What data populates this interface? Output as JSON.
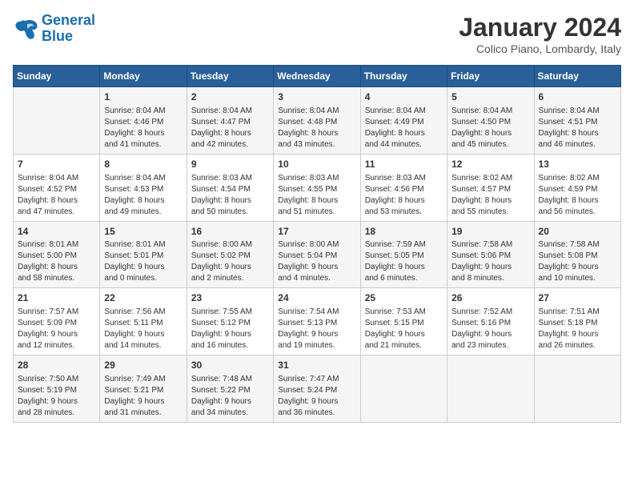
{
  "logo": {
    "text_general": "General",
    "text_blue": "Blue"
  },
  "header": {
    "month": "January 2024",
    "location": "Colico Piano, Lombardy, Italy"
  },
  "weekdays": [
    "Sunday",
    "Monday",
    "Tuesday",
    "Wednesday",
    "Thursday",
    "Friday",
    "Saturday"
  ],
  "weeks": [
    [
      {
        "day": "",
        "info": ""
      },
      {
        "day": "1",
        "info": "Sunrise: 8:04 AM\nSunset: 4:46 PM\nDaylight: 8 hours\nand 41 minutes."
      },
      {
        "day": "2",
        "info": "Sunrise: 8:04 AM\nSunset: 4:47 PM\nDaylight: 8 hours\nand 42 minutes."
      },
      {
        "day": "3",
        "info": "Sunrise: 8:04 AM\nSunset: 4:48 PM\nDaylight: 8 hours\nand 43 minutes."
      },
      {
        "day": "4",
        "info": "Sunrise: 8:04 AM\nSunset: 4:49 PM\nDaylight: 8 hours\nand 44 minutes."
      },
      {
        "day": "5",
        "info": "Sunrise: 8:04 AM\nSunset: 4:50 PM\nDaylight: 8 hours\nand 45 minutes."
      },
      {
        "day": "6",
        "info": "Sunrise: 8:04 AM\nSunset: 4:51 PM\nDaylight: 8 hours\nand 46 minutes."
      }
    ],
    [
      {
        "day": "7",
        "info": "Sunrise: 8:04 AM\nSunset: 4:52 PM\nDaylight: 8 hours\nand 47 minutes."
      },
      {
        "day": "8",
        "info": "Sunrise: 8:04 AM\nSunset: 4:53 PM\nDaylight: 8 hours\nand 49 minutes."
      },
      {
        "day": "9",
        "info": "Sunrise: 8:03 AM\nSunset: 4:54 PM\nDaylight: 8 hours\nand 50 minutes."
      },
      {
        "day": "10",
        "info": "Sunrise: 8:03 AM\nSunset: 4:55 PM\nDaylight: 8 hours\nand 51 minutes."
      },
      {
        "day": "11",
        "info": "Sunrise: 8:03 AM\nSunset: 4:56 PM\nDaylight: 8 hours\nand 53 minutes."
      },
      {
        "day": "12",
        "info": "Sunrise: 8:02 AM\nSunset: 4:57 PM\nDaylight: 8 hours\nand 55 minutes."
      },
      {
        "day": "13",
        "info": "Sunrise: 8:02 AM\nSunset: 4:59 PM\nDaylight: 8 hours\nand 56 minutes."
      }
    ],
    [
      {
        "day": "14",
        "info": "Sunrise: 8:01 AM\nSunset: 5:00 PM\nDaylight: 8 hours\nand 58 minutes."
      },
      {
        "day": "15",
        "info": "Sunrise: 8:01 AM\nSunset: 5:01 PM\nDaylight: 9 hours\nand 0 minutes."
      },
      {
        "day": "16",
        "info": "Sunrise: 8:00 AM\nSunset: 5:02 PM\nDaylight: 9 hours\nand 2 minutes."
      },
      {
        "day": "17",
        "info": "Sunrise: 8:00 AM\nSunset: 5:04 PM\nDaylight: 9 hours\nand 4 minutes."
      },
      {
        "day": "18",
        "info": "Sunrise: 7:59 AM\nSunset: 5:05 PM\nDaylight: 9 hours\nand 6 minutes."
      },
      {
        "day": "19",
        "info": "Sunrise: 7:58 AM\nSunset: 5:06 PM\nDaylight: 9 hours\nand 8 minutes."
      },
      {
        "day": "20",
        "info": "Sunrise: 7:58 AM\nSunset: 5:08 PM\nDaylight: 9 hours\nand 10 minutes."
      }
    ],
    [
      {
        "day": "21",
        "info": "Sunrise: 7:57 AM\nSunset: 5:09 PM\nDaylight: 9 hours\nand 12 minutes."
      },
      {
        "day": "22",
        "info": "Sunrise: 7:56 AM\nSunset: 5:11 PM\nDaylight: 9 hours\nand 14 minutes."
      },
      {
        "day": "23",
        "info": "Sunrise: 7:55 AM\nSunset: 5:12 PM\nDaylight: 9 hours\nand 16 minutes."
      },
      {
        "day": "24",
        "info": "Sunrise: 7:54 AM\nSunset: 5:13 PM\nDaylight: 9 hours\nand 19 minutes."
      },
      {
        "day": "25",
        "info": "Sunrise: 7:53 AM\nSunset: 5:15 PM\nDaylight: 9 hours\nand 21 minutes."
      },
      {
        "day": "26",
        "info": "Sunrise: 7:52 AM\nSunset: 5:16 PM\nDaylight: 9 hours\nand 23 minutes."
      },
      {
        "day": "27",
        "info": "Sunrise: 7:51 AM\nSunset: 5:18 PM\nDaylight: 9 hours\nand 26 minutes."
      }
    ],
    [
      {
        "day": "28",
        "info": "Sunrise: 7:50 AM\nSunset: 5:19 PM\nDaylight: 9 hours\nand 28 minutes."
      },
      {
        "day": "29",
        "info": "Sunrise: 7:49 AM\nSunset: 5:21 PM\nDaylight: 9 hours\nand 31 minutes."
      },
      {
        "day": "30",
        "info": "Sunrise: 7:48 AM\nSunset: 5:22 PM\nDaylight: 9 hours\nand 34 minutes."
      },
      {
        "day": "31",
        "info": "Sunrise: 7:47 AM\nSunset: 5:24 PM\nDaylight: 9 hours\nand 36 minutes."
      },
      {
        "day": "",
        "info": ""
      },
      {
        "day": "",
        "info": ""
      },
      {
        "day": "",
        "info": ""
      }
    ]
  ]
}
